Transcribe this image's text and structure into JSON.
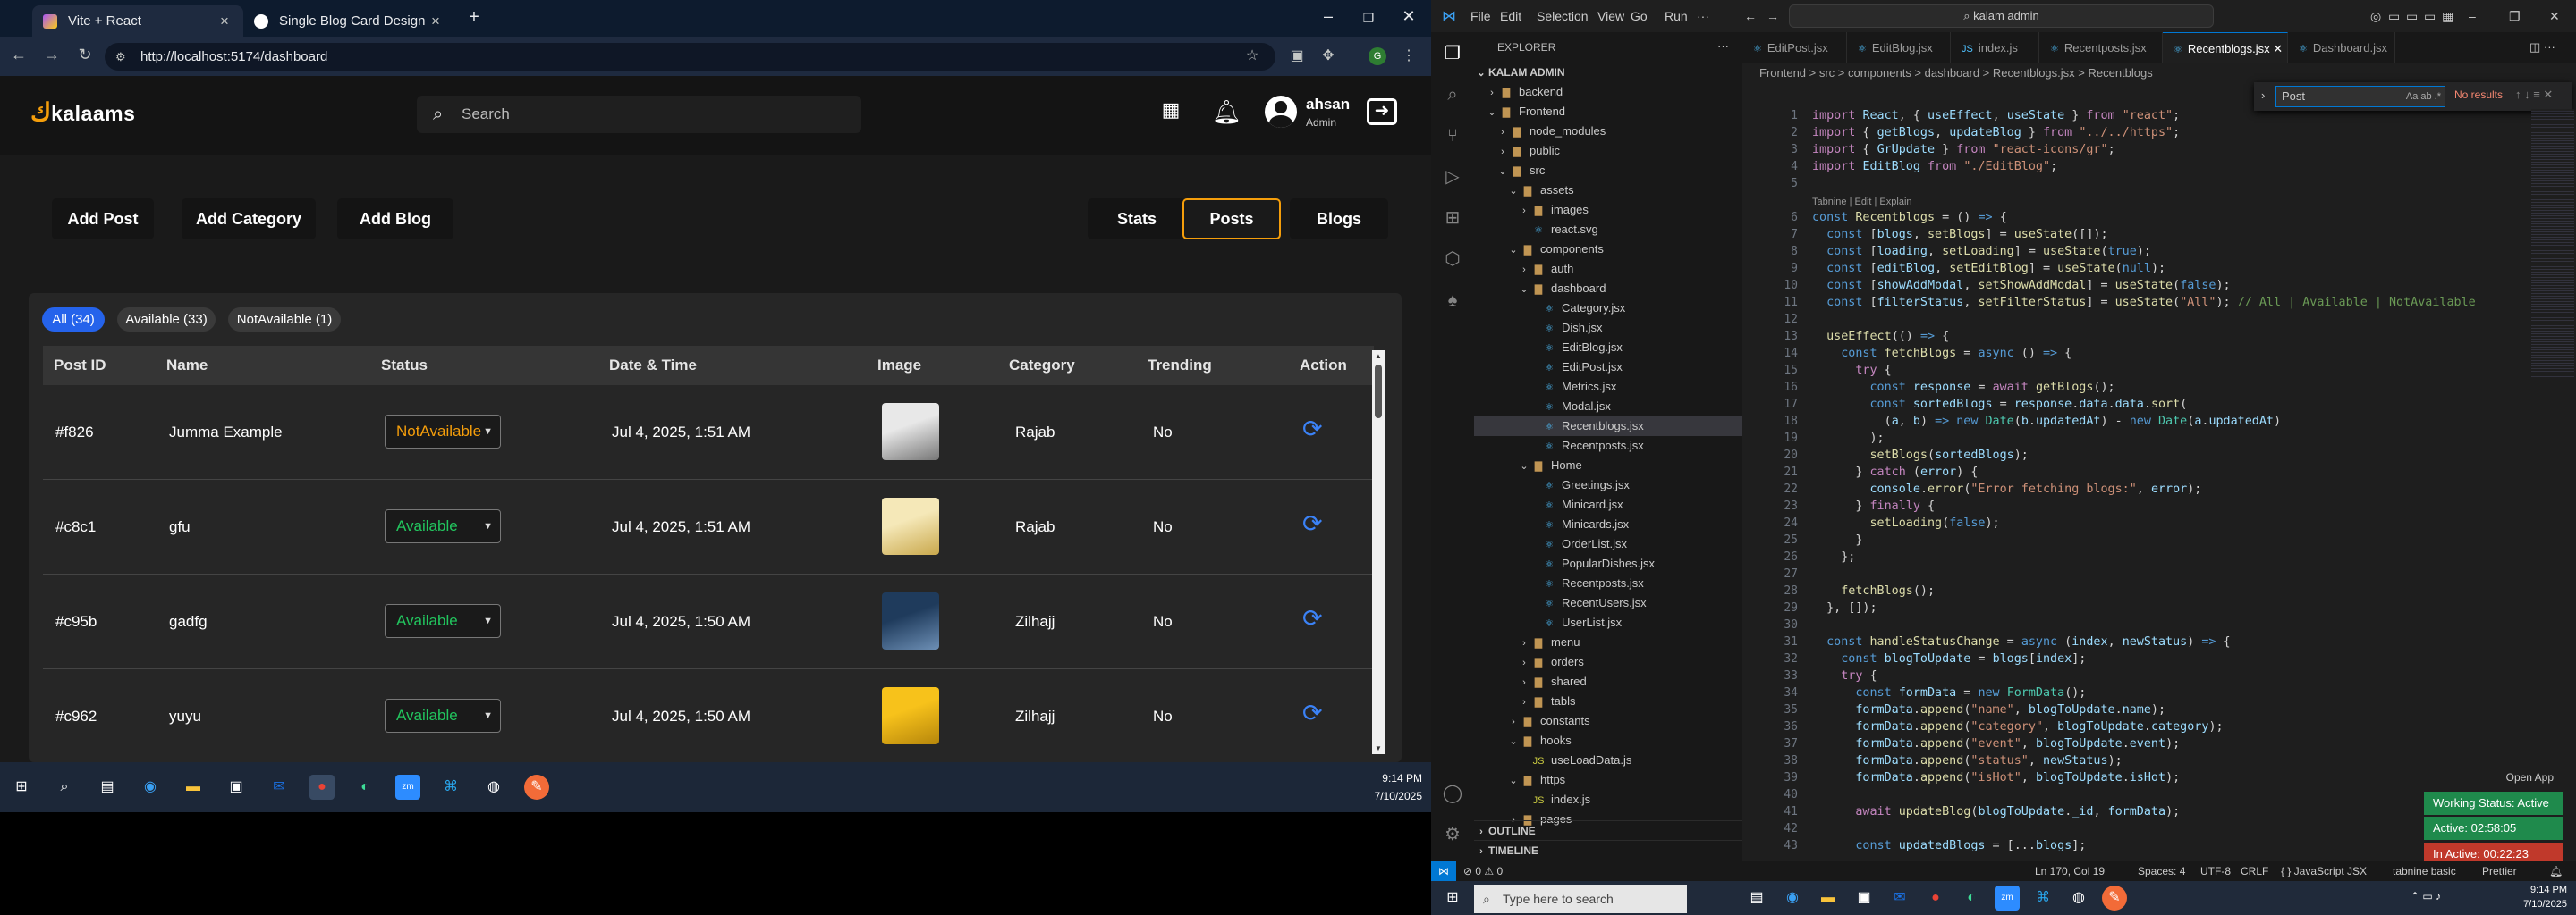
{
  "browser": {
    "tabs": [
      {
        "title": "Vite + React",
        "active": true
      },
      {
        "title": "Single Blog Card Design",
        "active": false
      }
    ],
    "new_tab_icon": "plus-icon",
    "url": "http://localhost:5174/dashboard"
  },
  "app": {
    "logo": "kalaams",
    "search_placeholder": "Search",
    "user_name": "ahsan",
    "user_role": "Admin",
    "actions": [
      "Add Post",
      "Add Category",
      "Add Blog"
    ],
    "views": [
      {
        "label": "Stats",
        "selected": false
      },
      {
        "label": "Posts",
        "selected": true
      },
      {
        "label": "Blogs",
        "selected": false
      }
    ],
    "filters": [
      {
        "label": "All (34)",
        "active": true
      },
      {
        "label": "Available (33)",
        "active": false
      },
      {
        "label": "NotAvailable (1)",
        "active": false
      }
    ],
    "columns": [
      "Post ID",
      "Name",
      "Status",
      "Date & Time",
      "Image",
      "Category",
      "Trending",
      "Action"
    ],
    "rows": [
      {
        "id": "#f826",
        "name": "Jumma Example",
        "status": "NotAvailable",
        "date": "Jul 4, 2025, 1:51 AM",
        "category": "Rajab",
        "trending": "No",
        "status_color": "#f59e0b"
      },
      {
        "id": "#c8c1",
        "name": "gfu",
        "status": "Available",
        "date": "Jul 4, 2025, 1:51 AM",
        "category": "Rajab",
        "trending": "No",
        "status_color": "#22c55e"
      },
      {
        "id": "#c95b",
        "name": "gadfg",
        "status": "Available",
        "date": "Jul 4, 2025, 1:50 AM",
        "category": "Zilhajj",
        "trending": "No",
        "status_color": "#22c55e"
      },
      {
        "id": "#c962",
        "name": "yuyu",
        "status": "Available",
        "date": "Jul 4, 2025, 1:50 AM",
        "category": "Zilhajj",
        "trending": "No",
        "status_color": "#22c55e"
      }
    ],
    "accent": "#f59e0b"
  },
  "taskbar_left": {
    "time": "9:14 PM",
    "date": "7/10/2025"
  },
  "vscode": {
    "menu": [
      "File",
      "Edit",
      "Selection",
      "View",
      "Go",
      "Run",
      "···"
    ],
    "command_center": "kalam admin",
    "explorer_title": "EXPLORER",
    "root": "KALAM ADMIN",
    "tree": [
      {
        "label": "backend",
        "depth": 1,
        "type": "folder",
        "open": false
      },
      {
        "label": "Frontend",
        "depth": 1,
        "type": "folder",
        "open": true
      },
      {
        "label": "node_modules",
        "depth": 2,
        "type": "folder",
        "open": false
      },
      {
        "label": "public",
        "depth": 2,
        "type": "folder",
        "open": false
      },
      {
        "label": "src",
        "depth": 2,
        "type": "folder",
        "open": true
      },
      {
        "label": "assets",
        "depth": 3,
        "type": "folder",
        "open": true
      },
      {
        "label": "images",
        "depth": 4,
        "type": "folder",
        "open": false
      },
      {
        "label": "react.svg",
        "depth": 4,
        "type": "file"
      },
      {
        "label": "components",
        "depth": 3,
        "type": "folder",
        "open": true
      },
      {
        "label": "auth",
        "depth": 4,
        "type": "folder",
        "open": false
      },
      {
        "label": "dashboard",
        "depth": 4,
        "type": "folder",
        "open": true
      },
      {
        "label": "Category.jsx",
        "depth": 5,
        "type": "jsx"
      },
      {
        "label": "Dish.jsx",
        "depth": 5,
        "type": "jsx"
      },
      {
        "label": "EditBlog.jsx",
        "depth": 5,
        "type": "jsx"
      },
      {
        "label": "EditPost.jsx",
        "depth": 5,
        "type": "jsx"
      },
      {
        "label": "Metrics.jsx",
        "depth": 5,
        "type": "jsx"
      },
      {
        "label": "Modal.jsx",
        "depth": 5,
        "type": "jsx"
      },
      {
        "label": "Recentblogs.jsx",
        "depth": 5,
        "type": "jsx",
        "selected": true
      },
      {
        "label": "Recentposts.jsx",
        "depth": 5,
        "type": "jsx"
      },
      {
        "label": "Home",
        "depth": 4,
        "type": "folder",
        "open": true
      },
      {
        "label": "Greetings.jsx",
        "depth": 5,
        "type": "jsx"
      },
      {
        "label": "Minicard.jsx",
        "depth": 5,
        "type": "jsx"
      },
      {
        "label": "Minicards.jsx",
        "depth": 5,
        "type": "jsx"
      },
      {
        "label": "OrderList.jsx",
        "depth": 5,
        "type": "jsx"
      },
      {
        "label": "PopularDishes.jsx",
        "depth": 5,
        "type": "jsx"
      },
      {
        "label": "Recentposts.jsx",
        "depth": 5,
        "type": "jsx"
      },
      {
        "label": "RecentUsers.jsx",
        "depth": 5,
        "type": "jsx"
      },
      {
        "label": "UserList.jsx",
        "depth": 5,
        "type": "jsx"
      },
      {
        "label": "menu",
        "depth": 4,
        "type": "folder",
        "open": false
      },
      {
        "label": "orders",
        "depth": 4,
        "type": "folder",
        "open": false
      },
      {
        "label": "shared",
        "depth": 4,
        "type": "folder",
        "open": false
      },
      {
        "label": "tabls",
        "depth": 4,
        "type": "folder",
        "open": false
      },
      {
        "label": "constants",
        "depth": 3,
        "type": "folder",
        "open": false
      },
      {
        "label": "hooks",
        "depth": 3,
        "type": "folder",
        "open": true
      },
      {
        "label": "useLoadData.js",
        "depth": 4,
        "type": "js"
      },
      {
        "label": "https",
        "depth": 3,
        "type": "folder",
        "open": true
      },
      {
        "label": "index.js",
        "depth": 4,
        "type": "js"
      },
      {
        "label": "pages",
        "depth": 3,
        "type": "folder",
        "open": false
      }
    ],
    "outline": "OUTLINE",
    "timeline": "TIMELINE",
    "tabs": [
      {
        "label": "EditPost.jsx",
        "active": false
      },
      {
        "label": "EditBlog.jsx",
        "active": false
      },
      {
        "label": "index.js",
        "active": false
      },
      {
        "label": "Recentposts.jsx",
        "active": false
      },
      {
        "label": "Recentblogs.jsx",
        "active": true
      },
      {
        "label": "Dashboard.jsx",
        "active": false
      }
    ],
    "breadcrumb": "Frontend > src > components > dashboard > Recentblogs.jsx > Recentblogs",
    "find": {
      "query": "Post",
      "result": "No results"
    },
    "tabnine_hint": "Tabnine | Edit | Explain",
    "status": {
      "errors": "⊘ 0 ⚠ 0",
      "position": "Ln 170, Col 19",
      "spaces": "Spaces: 4",
      "encoding": "UTF-8",
      "eol": "CRLF",
      "language": "{ } JavaScript JSX",
      "tabnine": "tabnine basic",
      "prettier": "Prettier"
    },
    "badges": [
      {
        "text": "Open App",
        "color": "#1e1e1e"
      },
      {
        "text": "Working Status: Active",
        "color": "#1f8a4c"
      },
      {
        "text": "Active: 02:58:05",
        "color": "#1f8a4c"
      },
      {
        "text": "In Active: 00:22:23",
        "color": "#c0392b"
      }
    ]
  },
  "taskbar_right": {
    "search": "Type here to search",
    "time": "9:14 PM",
    "date": "7/10/2025"
  }
}
